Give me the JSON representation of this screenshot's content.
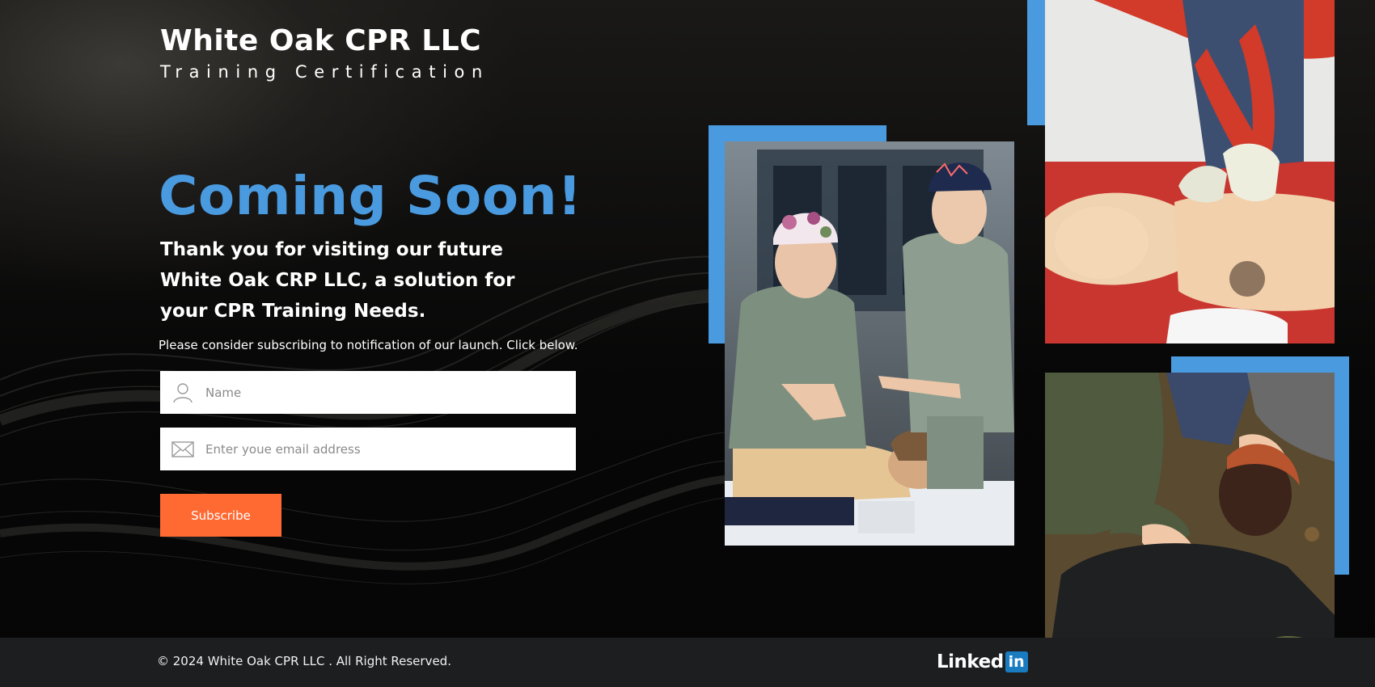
{
  "brand": {
    "title": "White Oak CPR LLC",
    "subtitle": "Training Certification"
  },
  "hero": {
    "heading": "Coming Soon!",
    "message": "Thank you for visiting our future White Oak CRP LLC, a solution for your CPR Training Needs.",
    "prompt": "Please consider subscribing to notification of our launch. Click below."
  },
  "form": {
    "name_placeholder": "Name",
    "email_placeholder": "Enter youe email address",
    "name_icon": "user-icon",
    "email_icon": "envelope-icon",
    "subscribe_label": "Subscribe"
  },
  "footer": {
    "copyright": "© 2024 White Oak CPR LLC . All Right Reserved.",
    "linkedin_text": "Linked",
    "linkedin_box": "in"
  },
  "colors": {
    "accent_blue": "#4a9ae0",
    "subscribe_orange": "#ff6a33",
    "linkedin_blue": "#1a7cc0",
    "footer_bg": "#1d1e20"
  }
}
